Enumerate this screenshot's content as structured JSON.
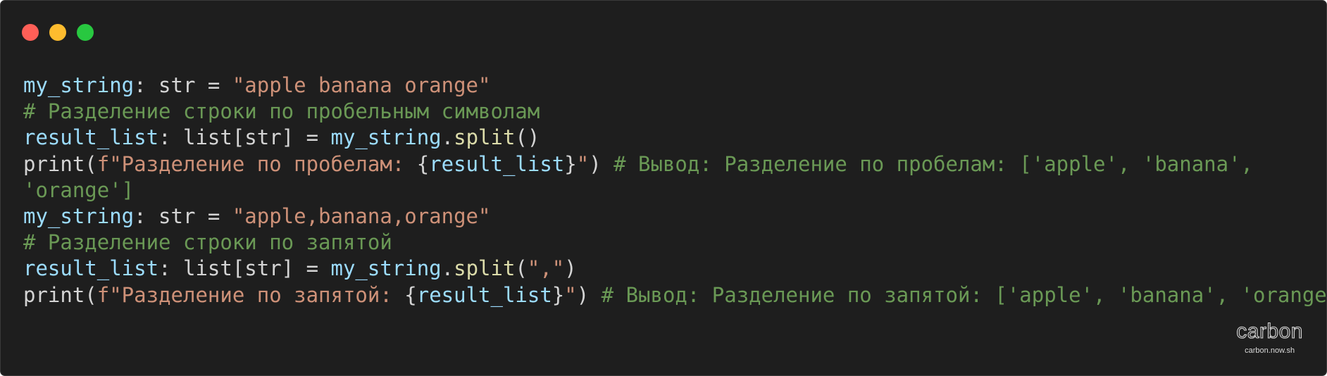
{
  "window": {
    "background": "#1e1e1e",
    "controls": [
      {
        "name": "close",
        "color": "#ff5f57"
      },
      {
        "name": "minimize",
        "color": "#febc2e"
      },
      {
        "name": "maximize",
        "color": "#28c840"
      }
    ]
  },
  "theme": {
    "variable": "#9cdcfe",
    "string": "#ce9178",
    "comment": "#6a9955",
    "function": "#dcdcaa",
    "plain": "#d4d4d4"
  },
  "code": {
    "lines": [
      [
        {
          "type": "var",
          "text": "my_string"
        },
        {
          "type": "plain",
          "text": ": str = "
        },
        {
          "type": "str",
          "text": "\"apple banana orange\""
        }
      ],
      [
        {
          "type": "cmt",
          "text": "# Разделение строки по пробельным символам"
        }
      ],
      [
        {
          "type": "var",
          "text": "result_list"
        },
        {
          "type": "plain",
          "text": ": list[str] = "
        },
        {
          "type": "var",
          "text": "my_string"
        },
        {
          "type": "plain",
          "text": "."
        },
        {
          "type": "fn",
          "text": "split"
        },
        {
          "type": "plain",
          "text": "()"
        }
      ],
      [
        {
          "type": "plain",
          "text": "print("
        },
        {
          "type": "str",
          "text": "f\"Разделение по пробелам: "
        },
        {
          "type": "plain",
          "text": "{"
        },
        {
          "type": "var",
          "text": "result_list"
        },
        {
          "type": "plain",
          "text": "}"
        },
        {
          "type": "str",
          "text": "\""
        },
        {
          "type": "plain",
          "text": ") "
        },
        {
          "type": "cmt",
          "text": "# Вывод: Разделение по пробелам: ['apple', 'banana',"
        }
      ],
      [
        {
          "type": "cmt",
          "text": "'orange']"
        }
      ],
      [
        {
          "type": "var",
          "text": "my_string"
        },
        {
          "type": "plain",
          "text": ": str = "
        },
        {
          "type": "str",
          "text": "\"apple,banana,orange\""
        }
      ],
      [
        {
          "type": "cmt",
          "text": "# Разделение строки по запятой"
        }
      ],
      [
        {
          "type": "var",
          "text": "result_list"
        },
        {
          "type": "plain",
          "text": ": list[str] = "
        },
        {
          "type": "var",
          "text": "my_string"
        },
        {
          "type": "plain",
          "text": "."
        },
        {
          "type": "fn",
          "text": "split"
        },
        {
          "type": "plain",
          "text": "("
        },
        {
          "type": "str",
          "text": "\",\""
        },
        {
          "type": "plain",
          "text": ")"
        }
      ],
      [
        {
          "type": "plain",
          "text": "print("
        },
        {
          "type": "str",
          "text": "f\"Разделение по запятой: "
        },
        {
          "type": "plain",
          "text": "{"
        },
        {
          "type": "var",
          "text": "result_list"
        },
        {
          "type": "plain",
          "text": "}"
        },
        {
          "type": "str",
          "text": "\""
        },
        {
          "type": "plain",
          "text": ") "
        },
        {
          "type": "cmt",
          "text": "# Вывод: Разделение по запятой: ['apple', 'banana', 'orange']"
        }
      ]
    ]
  },
  "brand": {
    "logo": "carbon",
    "url": "carbon.now.sh"
  }
}
